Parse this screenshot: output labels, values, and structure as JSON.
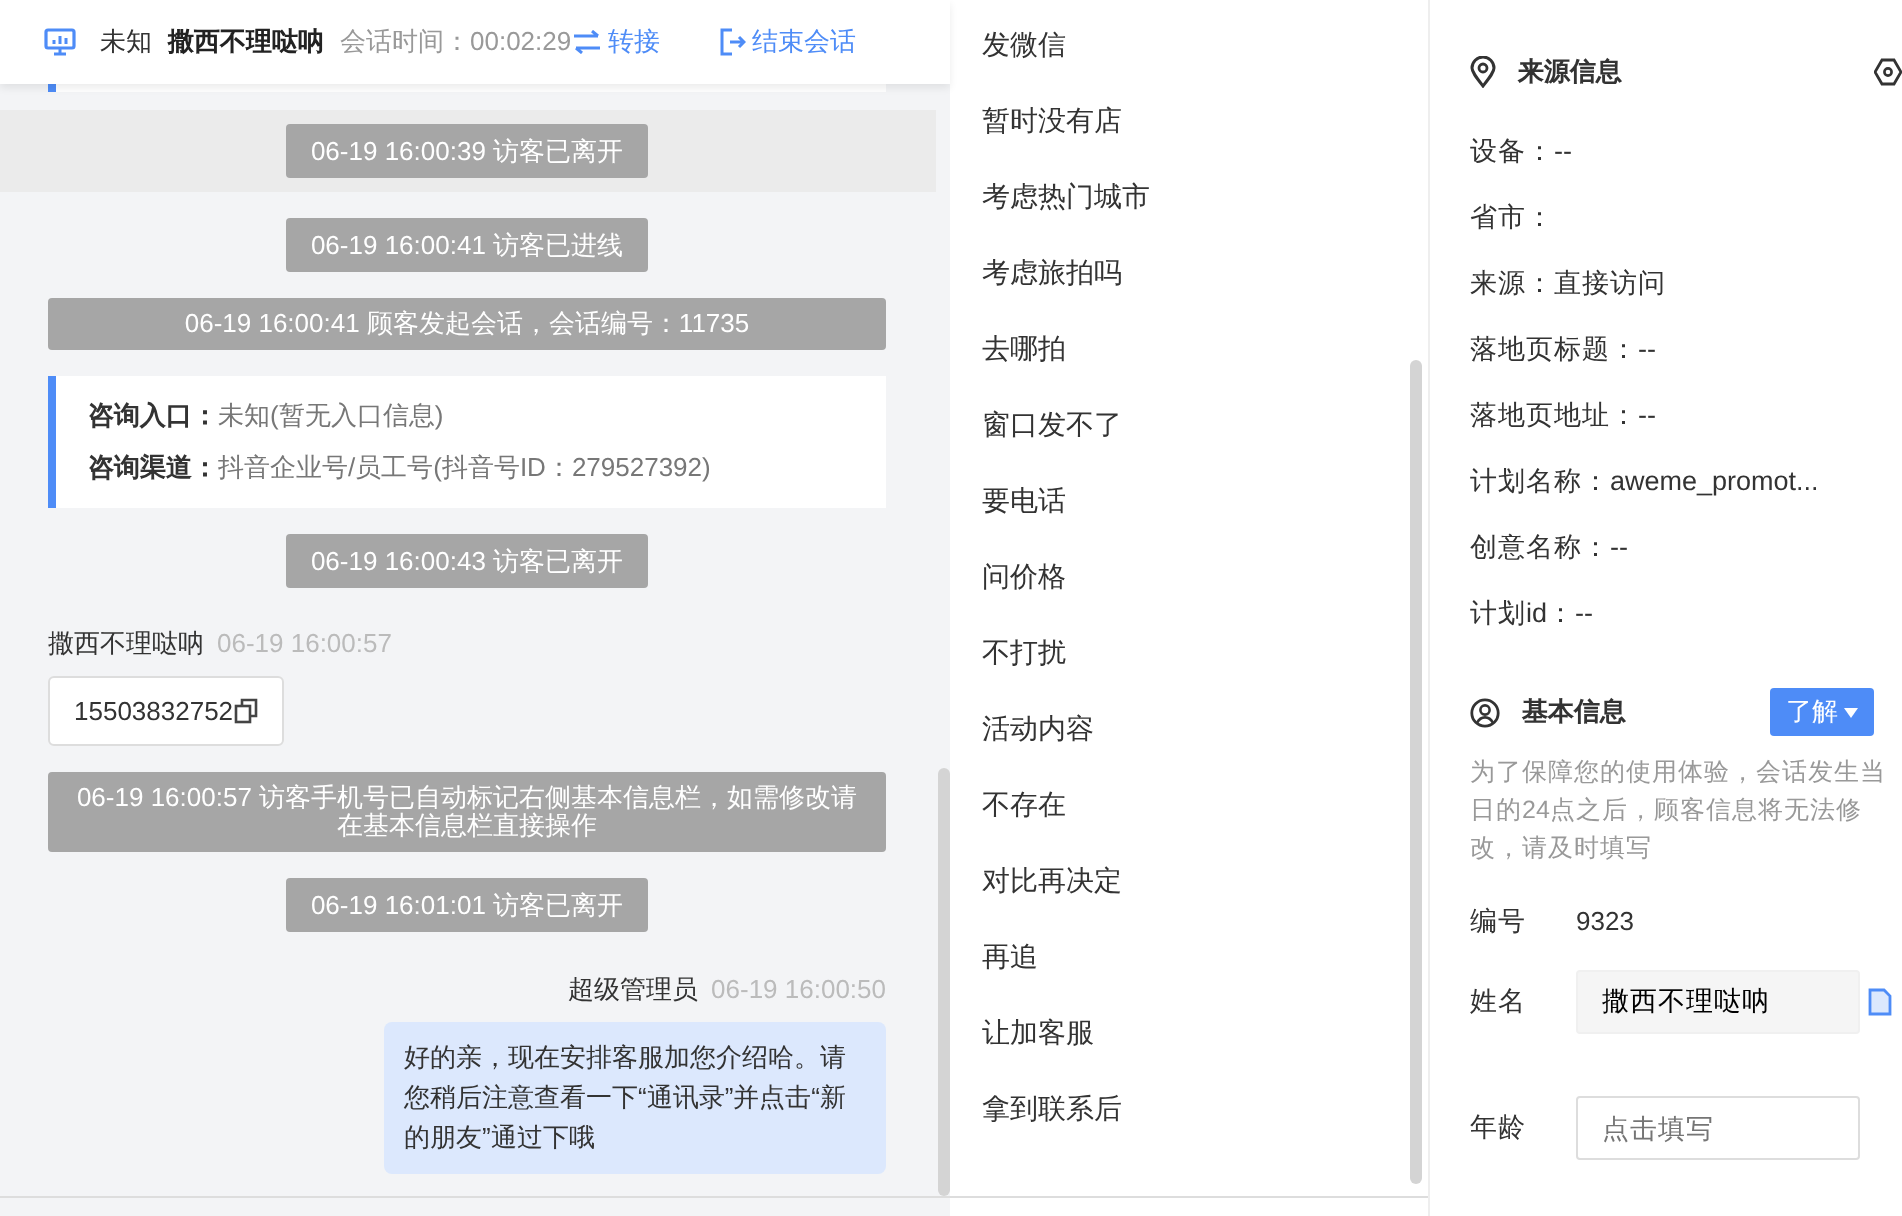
{
  "header": {
    "device": "未知",
    "visitor_name": "撒西不理哒呐",
    "timer": "会话时间：00:02:29",
    "transfer": "转接",
    "end": "结束会话"
  },
  "messages": [
    {
      "kind": "cut-card"
    },
    {
      "kind": "system",
      "text": "06-19 16:00:39 访客已离开",
      "highlighted": true
    },
    {
      "kind": "system",
      "text": "06-19 16:00:41 访客已进线",
      "highlighted": false
    },
    {
      "kind": "system",
      "text": "06-19 16:00:41 顾客发起会话，会话编号：11735",
      "highlighted": false
    },
    {
      "kind": "info",
      "lines": [
        {
          "label": "咨询入口：",
          "value": "未知(暂无入口信息)"
        },
        {
          "label": "咨询渠道：",
          "value": "抖音企业号/员工号(抖音号ID：279527392)"
        }
      ]
    },
    {
      "kind": "system",
      "text": "06-19 16:00:43 访客已离开",
      "highlighted": false
    },
    {
      "kind": "visitor",
      "sender": "撒西不理哒呐",
      "time": "06-19 16:00:57",
      "text": "15503832752"
    },
    {
      "kind": "system",
      "text": "06-19 16:00:57 访客手机号已自动标记右侧基本信息栏，如需修改请在基本信息栏直接操作",
      "highlighted": false
    },
    {
      "kind": "system",
      "text": "06-19 16:01:01 访客已离开",
      "highlighted": false
    },
    {
      "kind": "agent",
      "sender": "超级管理员",
      "time": "06-19 16:00:50",
      "text": "好的亲，现在安排客服加您介绍哈。请您稍后注意查看一下“通讯录”并点击“新的朋友”通过下哦"
    }
  ],
  "quick_replies": [
    "发微信",
    "暂时没有店",
    "考虑热门城市",
    "考虑旅拍吗",
    "去哪拍",
    "窗口发不了",
    "要电话",
    "问价格",
    "不打扰",
    "活动内容",
    "不存在",
    "对比再决定",
    "再追",
    "让加客服",
    "拿到联系后"
  ],
  "source_info": {
    "title": "来源信息",
    "rows": [
      "设备：--",
      "省市：",
      "来源：直接访问",
      "落地页标题：--",
      "落地页地址：--",
      "计划名称：aweme_promot...",
      "创意名称：--",
      "计划id：--"
    ]
  },
  "basic_info": {
    "title": "基本信息",
    "help": "了解",
    "note": "为了保障您的使用体验，会话发生当日的24点之后，顾客信息将无法修改，请及时填写",
    "fields": [
      {
        "kind": "text",
        "label": "编号",
        "value": "9323"
      },
      {
        "kind": "readonly",
        "label": "姓名",
        "value": "撒西不理哒呐"
      },
      {
        "kind": "input",
        "label": "年龄",
        "placeholder": "点击填写"
      }
    ]
  }
}
